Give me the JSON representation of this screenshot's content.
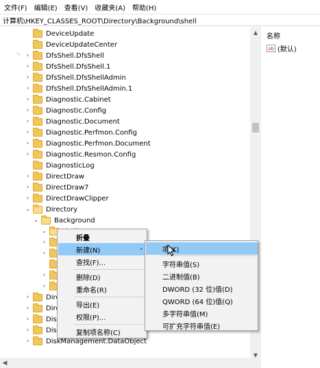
{
  "menubar": [
    "文件(F)",
    "编辑(E)",
    "查看(V)",
    "收藏夹(A)",
    "帮助(H)"
  ],
  "address": "计算机\\HKEY_CLASSES_ROOT\\Directory\\Background\\shell",
  "tree": [
    {
      "label": "DeviceUpdate",
      "expander": ""
    },
    {
      "label": "DeviceUpdateCenter",
      "expander": ""
    },
    {
      "label": "DfsShell.DfsShell",
      "expander": ">"
    },
    {
      "label": "DfsShell.DfsShell.1",
      "expander": ">"
    },
    {
      "label": "DfsShell.DfsShellAdmin",
      "expander": ">"
    },
    {
      "label": "DfsShell.DfsShellAdmin.1",
      "expander": ">"
    },
    {
      "label": "Diagnostic.Cabinet",
      "expander": ">"
    },
    {
      "label": "Diagnostic.Config",
      "expander": ">"
    },
    {
      "label": "Diagnostic.Document",
      "expander": ">"
    },
    {
      "label": "Diagnostic.Perfmon.Config",
      "expander": ">"
    },
    {
      "label": "Diagnostic.Perfmon.Document",
      "expander": ">"
    },
    {
      "label": "Diagnostic.Resmon.Config",
      "expander": ">"
    },
    {
      "label": "DiagnosticLog",
      "expander": ""
    },
    {
      "label": "DirectDraw",
      "expander": ">"
    },
    {
      "label": "DirectDraw7",
      "expander": ">"
    },
    {
      "label": "DirectDrawClipper",
      "expander": ">"
    },
    {
      "label": "Directory",
      "expander": "v"
    },
    {
      "label": "Background",
      "expander": "v"
    },
    {
      "label": "shell",
      "expander": "v"
    },
    {
      "label": "",
      "expander": ">"
    },
    {
      "label": "",
      "expander": ">"
    },
    {
      "label": "D",
      "expander": ""
    },
    {
      "label": "sh",
      "expander": ">"
    },
    {
      "label": "sh",
      "expander": ">"
    },
    {
      "label": "Direc",
      "expander": ">"
    },
    {
      "label": "Direc",
      "expander": ">"
    },
    {
      "label": "Disk",
      "expander": ">"
    },
    {
      "label": "DiskManagement.Control",
      "expander": ">"
    },
    {
      "label": "DiskManagement.DataObject",
      "expander": ">"
    }
  ],
  "values_pane": {
    "col_name": "名称",
    "default_value": "(默认)",
    "icon_text": "ab"
  },
  "context_menu": {
    "items": [
      {
        "label": "折叠",
        "bold": true
      },
      {
        "label": "新建(N)",
        "submenu": true
      },
      {
        "label": "查找(F)..."
      },
      {
        "label": "删除(D)"
      },
      {
        "label": "重命名(R)"
      },
      {
        "label": "导出(E)"
      },
      {
        "label": "权限(P)..."
      },
      {
        "label": "复制项名称(C)"
      }
    ]
  },
  "submenu": {
    "items": [
      "项(K)",
      "字符串值(S)",
      "二进制值(B)",
      "DWORD (32 位)值(D)",
      "QWORD (64 位)值(Q)",
      "多字符串值(M)",
      "可扩充字符串值(E)"
    ]
  },
  "colors": {
    "highlight": "#91c9f7",
    "folder": "#f3c65a"
  }
}
